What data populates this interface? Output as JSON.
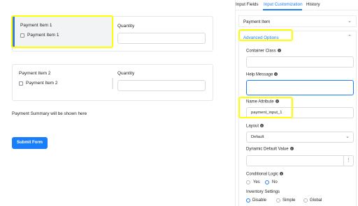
{
  "canvas": {
    "payment_item_1": {
      "label": "Payment Item 1",
      "option": "Payment Item 1"
    },
    "payment_item_2": {
      "label": "Payment Item 2",
      "option": "Payment Item 2"
    },
    "quantity_label": "Quantity",
    "summary_text": "Payment Summary will be shown here",
    "submit_label": "Submit Form"
  },
  "sidebar": {
    "tabs": [
      {
        "label": "Input Fields",
        "active": false
      },
      {
        "label": "Input Customization",
        "active": true
      },
      {
        "label": "History",
        "active": false
      }
    ],
    "element_panel": {
      "title": "Payment Item"
    },
    "advanced": {
      "title": "Advanced Options",
      "container_class": {
        "label": "Container Class",
        "value": ""
      },
      "help_message": {
        "label": "Help Message",
        "value": ""
      },
      "name_attribute": {
        "label": "Name Attribute",
        "value": "payment_input_1"
      },
      "layout": {
        "label": "Layout",
        "value": "Default"
      },
      "dynamic_default": {
        "label": "Dynamic Default Value",
        "value": ""
      },
      "conditional_logic": {
        "label": "Conditional Logic",
        "options": [
          "Yes",
          "No"
        ],
        "selected": "No"
      },
      "inventory": {
        "label": "Inventory Settings",
        "options": [
          "Disable",
          "Simple",
          "Global"
        ],
        "selected": "Disable"
      }
    }
  },
  "colors": {
    "accent": "#1a7efb",
    "highlight": "#ffff00"
  }
}
